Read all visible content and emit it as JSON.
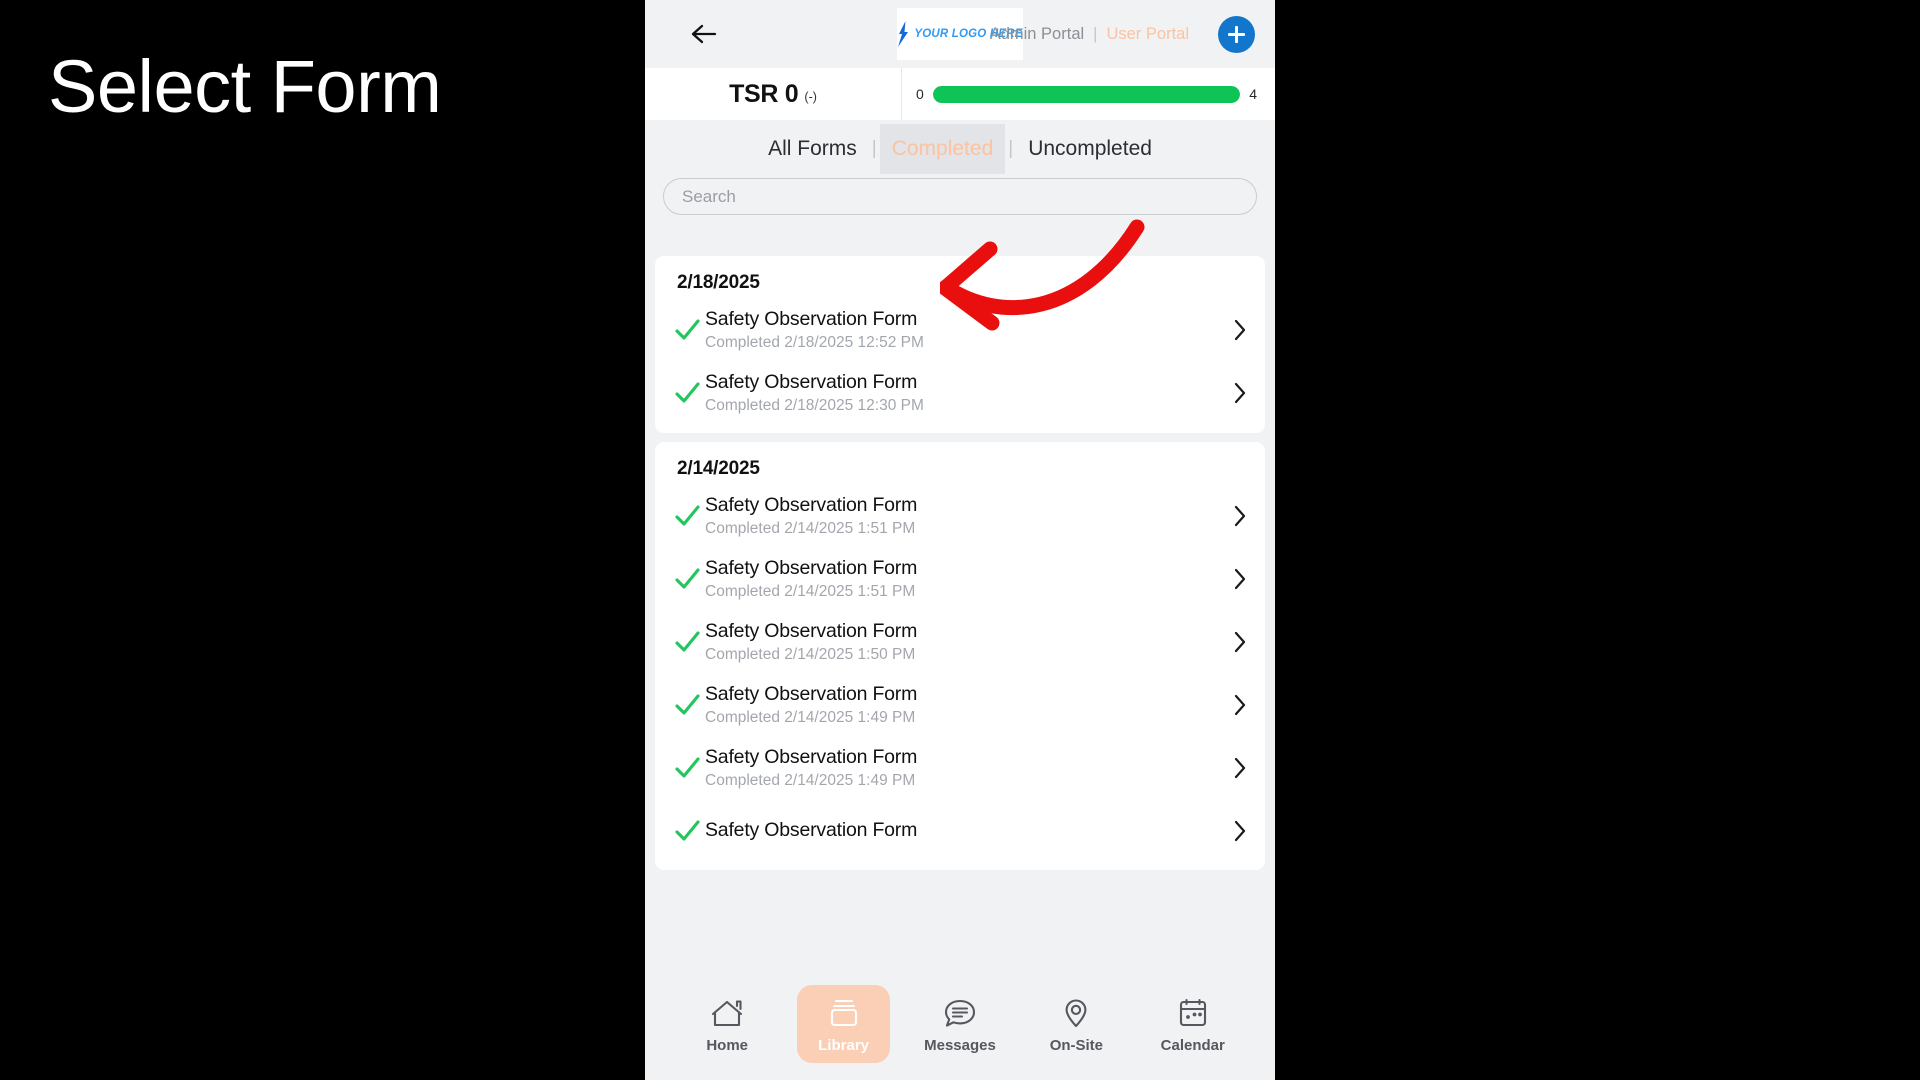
{
  "caption": "Select Form",
  "header": {
    "back_icon": "arrow-left-icon",
    "logo_text": "YOUR LOGO HERE",
    "admin_portal": "Admin Portal",
    "separator": "|",
    "user_portal": "User Portal",
    "add_icon": "plus-icon"
  },
  "tsr": {
    "label": "TSR 0",
    "sub": "(-)",
    "progress_min": "0",
    "progress_max": "4",
    "progress_percent": 100,
    "progress_color": "#0fc457"
  },
  "tabs": [
    {
      "label": "All Forms",
      "active": false
    },
    {
      "label": "Completed",
      "active": true
    },
    {
      "label": "Uncompleted",
      "active": false
    }
  ],
  "tab_divider": "|",
  "search": {
    "placeholder": "Search",
    "value": ""
  },
  "groups": [
    {
      "date": "2/18/2025",
      "items": [
        {
          "title": "Safety Observation Form",
          "status": "Completed 2/18/2025 12:52 PM"
        },
        {
          "title": "Safety Observation Form",
          "status": "Completed 2/18/2025 12:30 PM"
        }
      ]
    },
    {
      "date": "2/14/2025",
      "items": [
        {
          "title": "Safety Observation Form",
          "status": "Completed 2/14/2025 1:51 PM"
        },
        {
          "title": "Safety Observation Form",
          "status": "Completed 2/14/2025 1:51 PM"
        },
        {
          "title": "Safety Observation Form",
          "status": "Completed 2/14/2025 1:50 PM"
        },
        {
          "title": "Safety Observation Form",
          "status": "Completed 2/14/2025 1:49 PM"
        },
        {
          "title": "Safety Observation Form",
          "status": "Completed 2/14/2025 1:49 PM"
        },
        {
          "title": "Safety Observation Form",
          "status": ""
        }
      ]
    }
  ],
  "bottom_nav": [
    {
      "label": "Home",
      "icon": "home-icon",
      "active": false
    },
    {
      "label": "Library",
      "icon": "library-icon",
      "active": true
    },
    {
      "label": "Messages",
      "icon": "messages-icon",
      "active": false
    },
    {
      "label": "On-Site",
      "icon": "location-pin-icon",
      "active": false
    },
    {
      "label": "Calendar",
      "icon": "calendar-icon",
      "active": false
    }
  ],
  "annotation": {
    "type": "curved-arrow",
    "color": "#ea0f0f",
    "points_to": "first-form-row"
  },
  "colors": {
    "accent_peach": "#fbc3a1",
    "nav_active_bg": "#fbcfb5",
    "progress_green": "#0fc457",
    "add_button_blue": "#1277cc",
    "check_green": "#23c55e",
    "background": "#f1f2f4"
  }
}
